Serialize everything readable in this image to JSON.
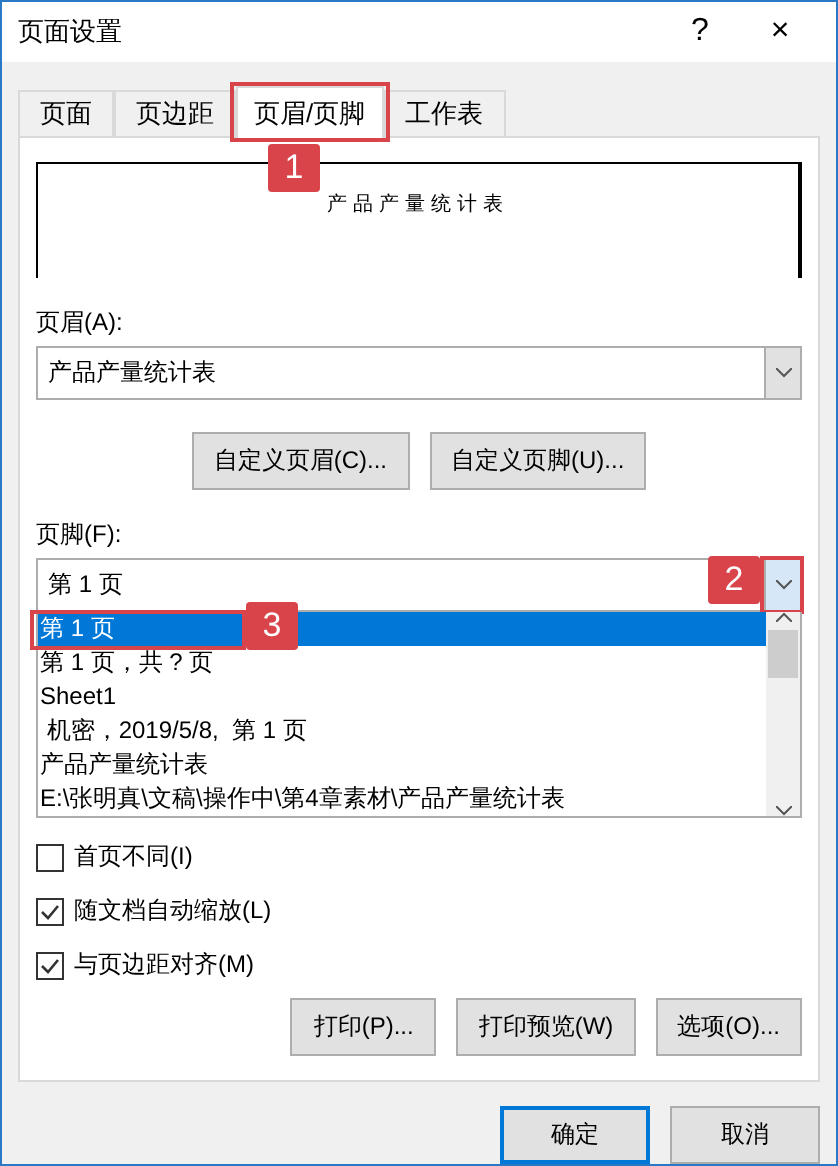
{
  "window": {
    "title": "页面设置",
    "help": "?",
    "close": "×"
  },
  "tabs": [
    {
      "label": "页面",
      "selected": false
    },
    {
      "label": "页边距",
      "selected": false
    },
    {
      "label": "页眉/页脚",
      "selected": true
    },
    {
      "label": "工作表",
      "selected": false
    }
  ],
  "header_preview": {
    "text": "产品产量统计表"
  },
  "header": {
    "label": "页眉(A):",
    "value": "产品产量统计表"
  },
  "custom_buttons": [
    "自定义页眉(C)...",
    "自定义页脚(U)..."
  ],
  "footer": {
    "label": "页脚(F):",
    "value": "第 1 页",
    "expanded": true,
    "options": [
      {
        "text": "第 1 页",
        "selected": true
      },
      {
        "text": "第 1 页，共 ? 页",
        "selected": false
      },
      {
        "text": "Sheet1",
        "selected": false
      },
      {
        "text": " 机密，2019/5/8,  第 1 页",
        "selected": false
      },
      {
        "text": "产品产量统计表",
        "selected": false
      },
      {
        "text": "E:\\张明真\\文稿\\操作中\\第4章素材\\产品产量统计表",
        "selected": false
      }
    ]
  },
  "checkboxes": [
    {
      "label": "首页不同(I)",
      "checked": false
    },
    {
      "label": "随文档自动缩放(L)",
      "checked": true
    },
    {
      "label": "与页边距对齐(M)",
      "checked": true
    }
  ],
  "panel_buttons": [
    "打印(P)...",
    "打印预览(W)",
    "选项(O)..."
  ],
  "dialog_buttons": [
    "确定",
    "取消"
  ],
  "callouts": [
    "1",
    "2",
    "3"
  ]
}
